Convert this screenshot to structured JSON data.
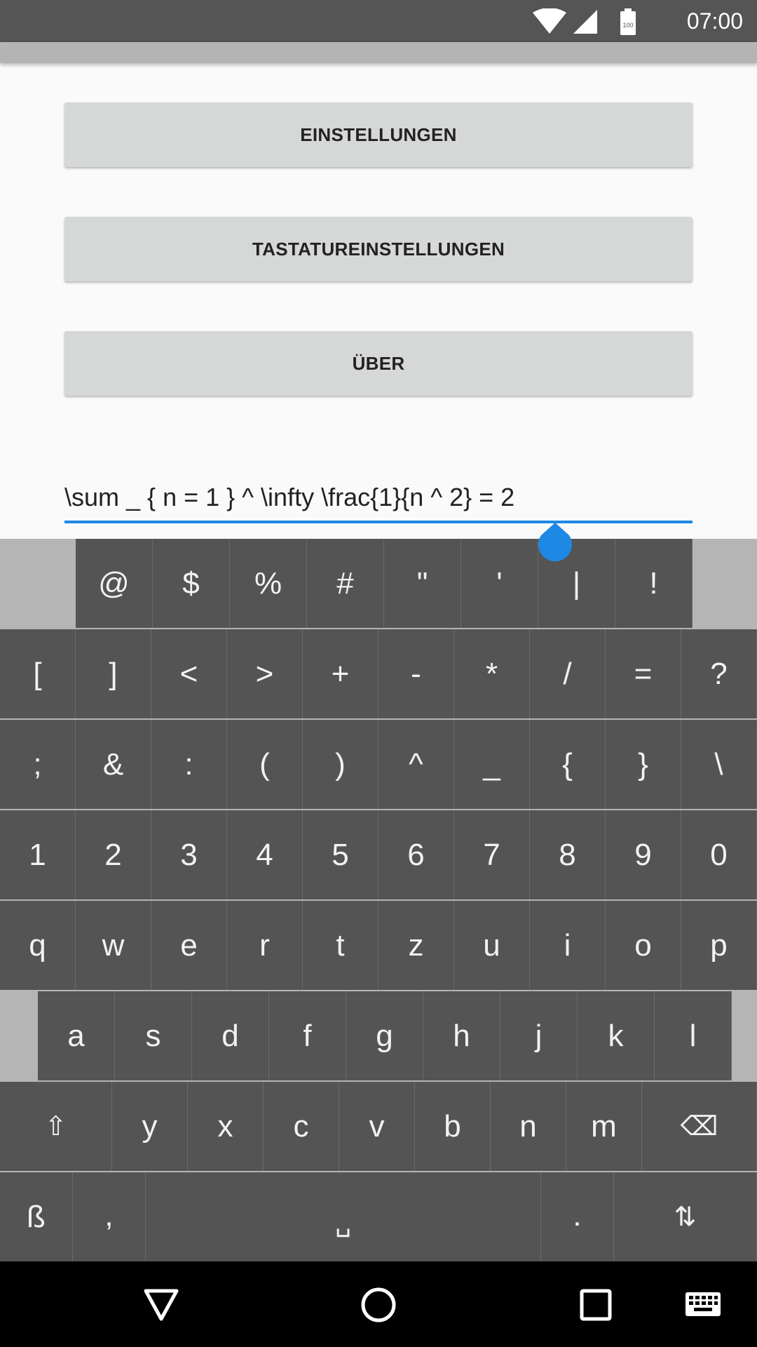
{
  "status_bar": {
    "time": "07:00",
    "battery_level": "100"
  },
  "buttons": {
    "settings": "EINSTELLUNGEN",
    "keyboard_settings": "TASTATUREINSTELLUNGEN",
    "about": "ÜBER"
  },
  "text_field": {
    "value": "\\sum _ { n = 1 } ^ \\infty \\frac{1}{n ^ 2} = 2"
  },
  "keyboard": {
    "row1": [
      "@",
      "$",
      "%",
      "#",
      "\"",
      "'",
      "|",
      "!"
    ],
    "row2": [
      "[",
      "]",
      "<",
      ">",
      "+",
      "-",
      "*",
      "/",
      "=",
      "?"
    ],
    "row3": [
      ";",
      "&",
      ":",
      "(",
      ")",
      "^",
      "_",
      "{",
      "}",
      "\\"
    ],
    "row4": [
      "1",
      "2",
      "3",
      "4",
      "5",
      "6",
      "7",
      "8",
      "9",
      "0"
    ],
    "row5": [
      "q",
      "w",
      "e",
      "r",
      "t",
      "z",
      "u",
      "i",
      "o",
      "p"
    ],
    "row6": [
      "a",
      "s",
      "d",
      "f",
      "g",
      "h",
      "j",
      "k",
      "l"
    ],
    "row7": [
      "⇧",
      "y",
      "x",
      "c",
      "v",
      "b",
      "n",
      "m",
      "⌫"
    ],
    "row8": [
      "ß",
      ",",
      "␣",
      ".",
      "⇅"
    ]
  },
  "icons": {
    "wifi": "wifi-icon",
    "signal": "cell-signal-icon",
    "battery": "battery-icon",
    "back": "back-icon",
    "home": "home-icon",
    "recents": "recents-icon",
    "keyboard": "keyboard-switch-icon"
  },
  "colors": {
    "accent": "#1e88e5",
    "key": "#545454",
    "keyboard_bg": "#b5b5b5"
  }
}
